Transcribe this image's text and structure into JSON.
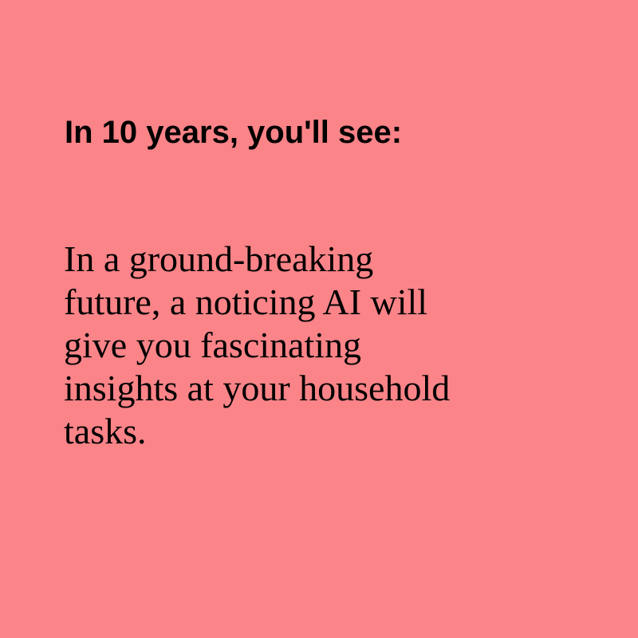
{
  "background_color": "#fa8488",
  "text_color": "#000000",
  "heading": "In 10 years, you'll see:",
  "body_lines": [
    "In a ground-breaking",
    "future, a noticing AI will",
    "give you fascinating",
    "insights at your household",
    "tasks."
  ]
}
